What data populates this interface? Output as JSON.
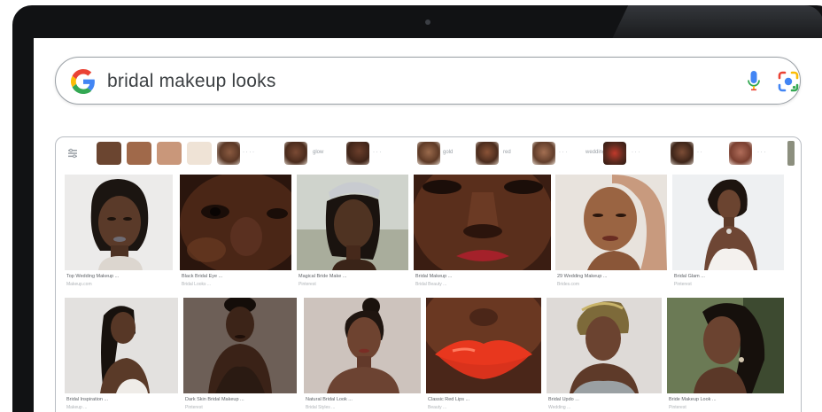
{
  "search": {
    "query": "bridal makeup looks"
  },
  "icons": {
    "google_logo": "google-g-logo",
    "mic": "microphone-icon",
    "lens": "google-lens-icon",
    "filter": "filter-icon"
  },
  "colors": {
    "google_blue": "#4285f4",
    "google_red": "#ea4335",
    "google_yellow": "#fbbc05",
    "google_green": "#34a853",
    "chip_swatches": [
      "#6b4530",
      "#a0694a",
      "#c9977a",
      "#efe3d6"
    ]
  },
  "chips": [
    {
      "label": ""
    },
    {
      "label": "·  ·  ·  ·"
    },
    {
      "label": "glow"
    },
    {
      "label": "·  ·  ·"
    },
    {
      "label": "gold"
    },
    {
      "label": "red"
    },
    {
      "label": "·  ·  ·"
    },
    {
      "label": "wedding"
    },
    {
      "label": "·  ·  ·"
    },
    {
      "label": "·  ·"
    },
    {
      "label": "·  ·  ·"
    }
  ],
  "results_row1": [
    {
      "caption": "Top Wedding Makeup ...",
      "source": "Makeup.com"
    },
    {
      "caption": "Black Bridal Eye ...",
      "source": "Bridal Looks ..."
    },
    {
      "caption": "Magical Bride Make ...",
      "source": "Pinterest"
    },
    {
      "caption": "Bridal Makeup ...",
      "source": "Bridal Beauty ..."
    },
    {
      "caption": "29 Wedding Makeup ...",
      "source": "Brides.com"
    },
    {
      "caption": "Bridal Glam ...",
      "source": "Pinterest"
    }
  ],
  "results_row2": [
    {
      "caption": "Bridal Inspiration ...",
      "source": "Makeup ..."
    },
    {
      "caption": "Dark Skin Bridal Makeup ...",
      "source": "Pinterest"
    },
    {
      "caption": "Natural Bridal Look ...",
      "source": "Bridal Styles ..."
    },
    {
      "caption": "Classic Red Lips ...",
      "source": "Beauty ..."
    },
    {
      "caption": "Bridal Updo ...",
      "source": "Wedding ..."
    },
    {
      "caption": "Bride Makeup Look ...",
      "source": "Pinterest"
    }
  ]
}
